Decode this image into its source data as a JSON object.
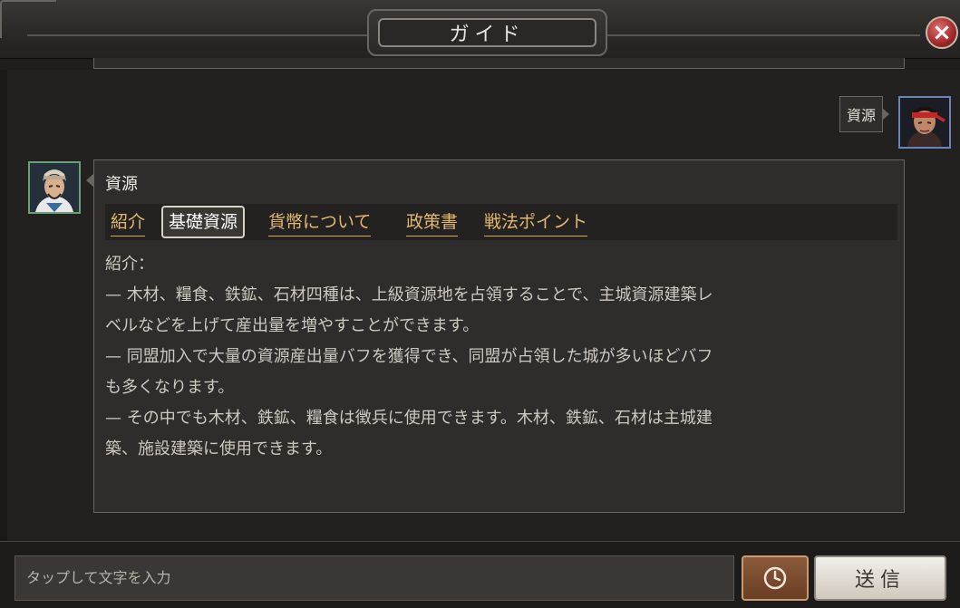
{
  "window": {
    "title": "ガイド",
    "close_label": "×"
  },
  "user_message": {
    "text": "資源"
  },
  "guide_message": {
    "title": "資源",
    "tabs": [
      {
        "label": "紹介",
        "active": false
      },
      {
        "label": "基礎資源",
        "active": true
      },
      {
        "label": "貨幣について",
        "active": false
      },
      {
        "label": "政策書",
        "active": false
      },
      {
        "label": "戦法ポイント",
        "active": false
      }
    ],
    "body_lines": [
      "紹介：",
      "— 木材、糧食、鉄鉱、石材四種は、上級資源地を占領することで、主城資源建築レ",
      "ベルなどを上げて産出量を増やすことができます。",
      "— 同盟加入で大量の資源産出量バフを獲得でき、同盟が占領した城が多いほどバフ",
      "も多くなります。",
      "— その中でも木材、鉄鉱、糧食は徴兵に使用できます。木材、鉄鉱、石材は主城建",
      "築、施設建築に使用できます。"
    ]
  },
  "input": {
    "placeholder": "タップして文字を入力"
  },
  "buttons": {
    "send_label": "送信",
    "history_icon": "clock-icon"
  }
}
